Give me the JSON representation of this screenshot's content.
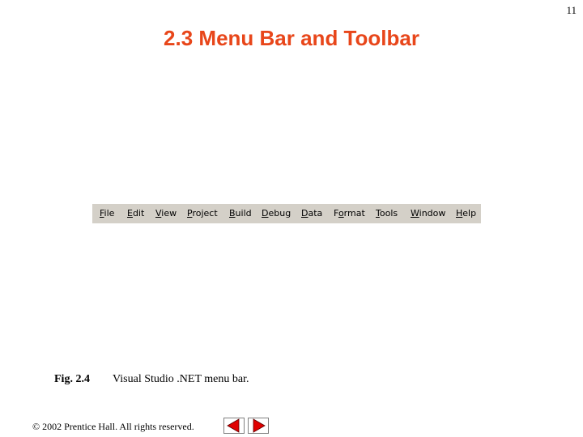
{
  "slide": {
    "number": "11",
    "title": "2.3  Menu Bar and Toolbar"
  },
  "menubar": {
    "items": [
      {
        "underlined": "F",
        "rest": "ile"
      },
      {
        "underlined": "E",
        "rest": "dit"
      },
      {
        "underlined": "V",
        "rest": "iew"
      },
      {
        "underlined": "P",
        "rest": "roject"
      },
      {
        "underlined": "B",
        "rest": "uild"
      },
      {
        "underlined": "D",
        "rest": "ebug"
      },
      {
        "underlined": "D",
        "rest": "ata"
      },
      {
        "pre": "F",
        "underlined": "o",
        "rest": "rmat"
      },
      {
        "underlined": "T",
        "rest": "ools"
      },
      {
        "underlined": "W",
        "rest": "indow"
      },
      {
        "underlined": "H",
        "rest": "elp"
      }
    ]
  },
  "figure": {
    "label": "Fig. 2.4",
    "caption": "Visual Studio .NET menu bar."
  },
  "footer": {
    "copyright": "© 2002 Prentice Hall.  All rights reserved.",
    "prev_icon": "left-arrow-icon",
    "next_icon": "right-arrow-icon"
  },
  "colors": {
    "title": "#e8461a",
    "menubar_bg": "#d4d0c8",
    "nav_arrow": "#e00000"
  }
}
